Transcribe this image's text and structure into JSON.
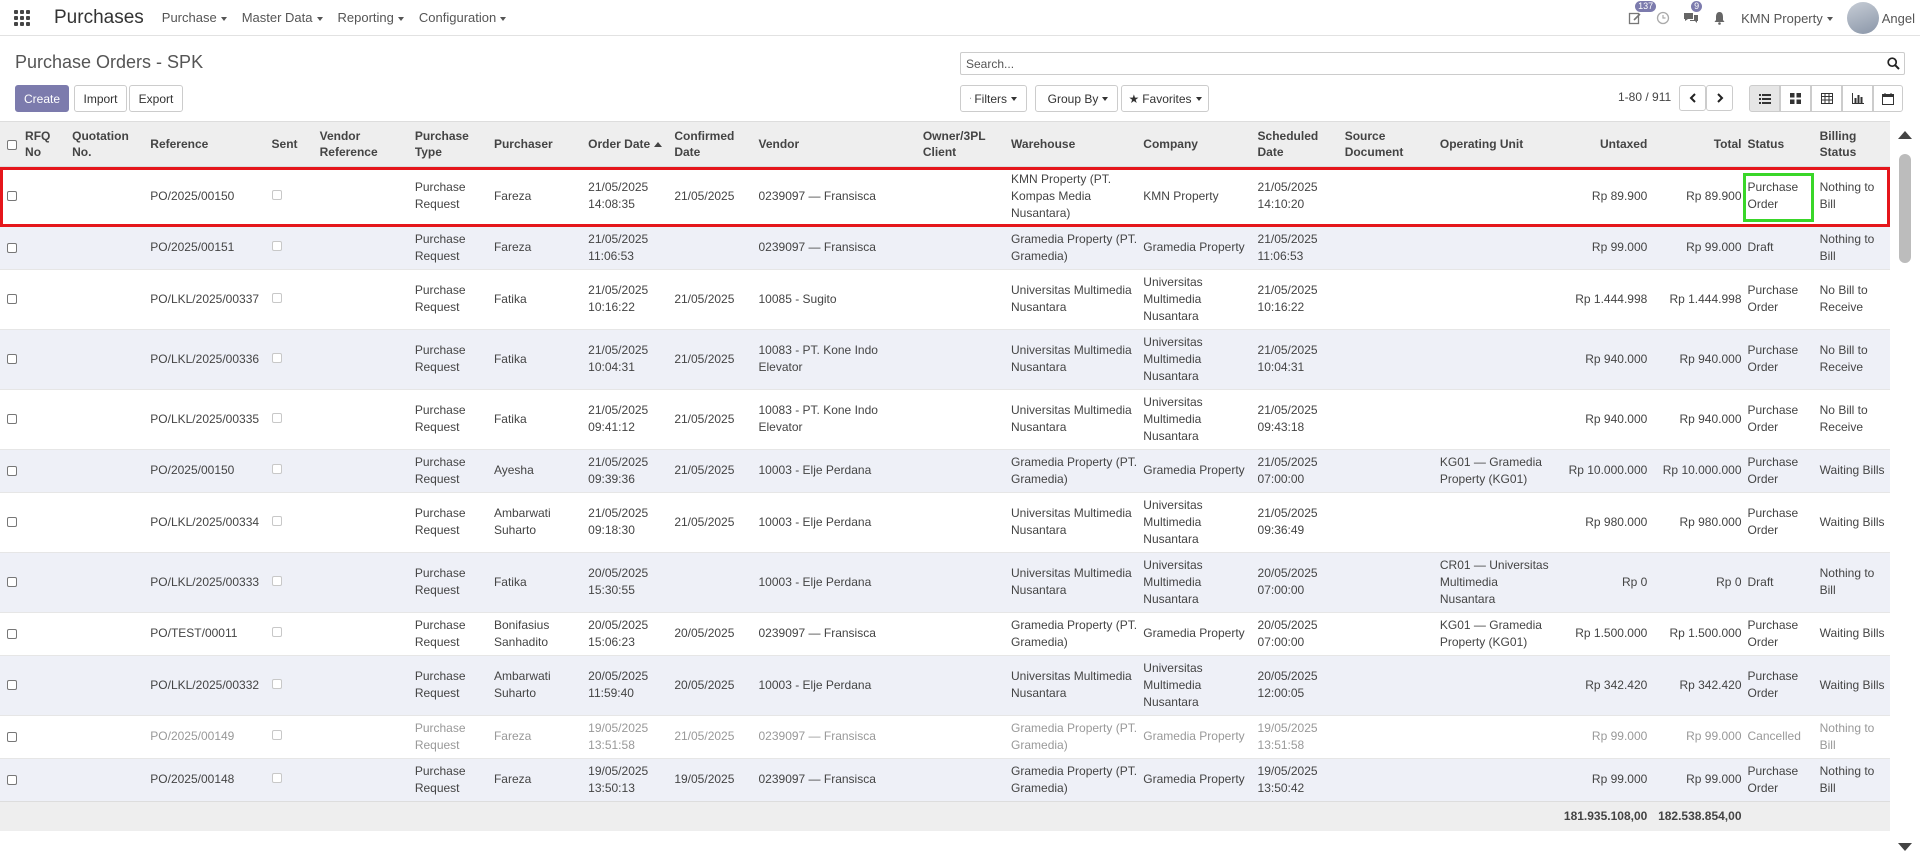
{
  "navbar": {
    "app_title": "Purchases",
    "menus": [
      "Purchase",
      "Master Data",
      "Reporting",
      "Configuration"
    ],
    "activity_badge": "137",
    "messages_badge": "9",
    "company": "KMN Property",
    "user": "Angel"
  },
  "control_panel": {
    "title": "Purchase Orders - SPK",
    "create_label": "Create",
    "import_label": "Import",
    "export_label": "Export",
    "search_placeholder": "Search...",
    "filters_label": "Filters",
    "groupby_label": "Group By",
    "favorites_label": "Favorites",
    "pager": "1-80 / 911"
  },
  "table": {
    "columns": {
      "rfq_no": "RFQ No",
      "quotation_no": "Quotation No.",
      "reference": "Reference",
      "sent": "Sent",
      "vendor_ref": "Vendor Reference",
      "purchase_type": "Purchase Type",
      "purchaser": "Purchaser",
      "order_date": "Order Date",
      "confirmed_date": "Confirmed Date",
      "vendor": "Vendor",
      "owner": "Owner/3PL Client",
      "warehouse": "Warehouse",
      "company": "Company",
      "scheduled_date": "Scheduled Date",
      "source_doc": "Source Document",
      "operating_unit": "Operating Unit",
      "untaxed": "Untaxed",
      "total": "Total",
      "status": "Status",
      "billing_status": "Billing Status"
    },
    "rows": [
      {
        "reference": "PO/2025/00150",
        "purchase_type": "Purchase Request",
        "purchaser": "Fareza",
        "order_date": "21/05/2025 14:08:35",
        "confirmed_date": "21/05/2025",
        "vendor": "0239097 — Fransisca",
        "warehouse": "KMN Property (PT. Kompas Media Nusantara)",
        "company": "KMN Property",
        "scheduled_date": "21/05/2025 14:10:20",
        "operating_unit": "",
        "untaxed": "Rp 89.900",
        "total": "Rp 89.900",
        "status": "Purchase Order",
        "billing_status": "Nothing to Bill"
      },
      {
        "reference": "PO/2025/00151",
        "purchase_type": "Purchase Request",
        "purchaser": "Fareza",
        "order_date": "21/05/2025 11:06:53",
        "confirmed_date": "",
        "vendor": "0239097 — Fransisca",
        "warehouse": "Gramedia Property (PT. Gramedia)",
        "company": "Gramedia Property",
        "scheduled_date": "21/05/2025 11:06:53",
        "operating_unit": "",
        "untaxed": "Rp 99.000",
        "total": "Rp 99.000",
        "status": "Draft",
        "billing_status": "Nothing to Bill"
      },
      {
        "reference": "PO/LKL/2025/00337",
        "purchase_type": "Purchase Request",
        "purchaser": "Fatika",
        "order_date": "21/05/2025 10:16:22",
        "confirmed_date": "21/05/2025",
        "vendor": "10085 - Sugito",
        "warehouse": "Universitas Multimedia Nusantara",
        "company": "Universitas Multimedia Nusantara",
        "scheduled_date": "21/05/2025 10:16:22",
        "operating_unit": "",
        "untaxed": "Rp 1.444.998",
        "total": "Rp 1.444.998",
        "status": "Purchase Order",
        "billing_status": "No Bill to Receive"
      },
      {
        "reference": "PO/LKL/2025/00336",
        "purchase_type": "Purchase Request",
        "purchaser": "Fatika",
        "order_date": "21/05/2025 10:04:31",
        "confirmed_date": "21/05/2025",
        "vendor": "10083 - PT. Kone Indo Elevator",
        "warehouse": "Universitas Multimedia Nusantara",
        "company": "Universitas Multimedia Nusantara",
        "scheduled_date": "21/05/2025 10:04:31",
        "operating_unit": "",
        "untaxed": "Rp 940.000",
        "total": "Rp 940.000",
        "status": "Purchase Order",
        "billing_status": "No Bill to Receive"
      },
      {
        "reference": "PO/LKL/2025/00335",
        "purchase_type": "Purchase Request",
        "purchaser": "Fatika",
        "order_date": "21/05/2025 09:41:12",
        "confirmed_date": "21/05/2025",
        "vendor": "10083 - PT. Kone Indo Elevator",
        "warehouse": "Universitas Multimedia Nusantara",
        "company": "Universitas Multimedia Nusantara",
        "scheduled_date": "21/05/2025 09:43:18",
        "operating_unit": "",
        "untaxed": "Rp 940.000",
        "total": "Rp 940.000",
        "status": "Purchase Order",
        "billing_status": "No Bill to Receive"
      },
      {
        "reference": "PO/2025/00150",
        "purchase_type": "Purchase Request",
        "purchaser": "Ayesha",
        "order_date": "21/05/2025 09:39:36",
        "confirmed_date": "21/05/2025",
        "vendor": "10003 - Elje Perdana",
        "warehouse": "Gramedia Property (PT. Gramedia)",
        "company": "Gramedia Property",
        "scheduled_date": "21/05/2025 07:00:00",
        "operating_unit": "KG01 — Gramedia Property (KG01)",
        "untaxed": "Rp 10.000.000",
        "total": "Rp 10.000.000",
        "status": "Purchase Order",
        "billing_status": "Waiting Bills"
      },
      {
        "reference": "PO/LKL/2025/00334",
        "purchase_type": "Purchase Request",
        "purchaser": "Ambarwati Suharto",
        "order_date": "21/05/2025 09:18:30",
        "confirmed_date": "21/05/2025",
        "vendor": "10003 - Elje Perdana",
        "warehouse": "Universitas Multimedia Nusantara",
        "company": "Universitas Multimedia Nusantara",
        "scheduled_date": "21/05/2025 09:36:49",
        "operating_unit": "",
        "untaxed": "Rp 980.000",
        "total": "Rp 980.000",
        "status": "Purchase Order",
        "billing_status": "Waiting Bills"
      },
      {
        "reference": "PO/LKL/2025/00333",
        "purchase_type": "Purchase Request",
        "purchaser": "Fatika",
        "order_date": "20/05/2025 15:30:55",
        "confirmed_date": "",
        "vendor": "10003 - Elje Perdana",
        "warehouse": "Universitas Multimedia Nusantara",
        "company": "Universitas Multimedia Nusantara",
        "scheduled_date": "20/05/2025 07:00:00",
        "operating_unit": "CR01 — Universitas Multimedia Nusantara",
        "untaxed": "Rp 0",
        "total": "Rp 0",
        "status": "Draft",
        "billing_status": "Nothing to Bill"
      },
      {
        "reference": "PO/TEST/00011",
        "purchase_type": "Purchase Request",
        "purchaser": "Bonifasius Sanhadito",
        "order_date": "20/05/2025 15:06:23",
        "confirmed_date": "20/05/2025",
        "vendor": "0239097 — Fransisca",
        "warehouse": "Gramedia Property (PT. Gramedia)",
        "company": "Gramedia Property",
        "scheduled_date": "20/05/2025 07:00:00",
        "operating_unit": "KG01 — Gramedia Property (KG01)",
        "untaxed": "Rp 1.500.000",
        "total": "Rp 1.500.000",
        "status": "Purchase Order",
        "billing_status": "Waiting Bills"
      },
      {
        "reference": "PO/LKL/2025/00332",
        "purchase_type": "Purchase Request",
        "purchaser": "Ambarwati Suharto",
        "order_date": "20/05/2025 11:59:40",
        "confirmed_date": "20/05/2025",
        "vendor": "10003 - Elje Perdana",
        "warehouse": "Universitas Multimedia Nusantara",
        "company": "Universitas Multimedia Nusantara",
        "scheduled_date": "20/05/2025 12:00:05",
        "operating_unit": "",
        "untaxed": "Rp 342.420",
        "total": "Rp 342.420",
        "status": "Purchase Order",
        "billing_status": "Waiting Bills"
      },
      {
        "reference": "PO/2025/00149",
        "purchase_type": "Purchase Request",
        "purchaser": "Fareza",
        "order_date": "19/05/2025 13:51:58",
        "confirmed_date": "21/05/2025",
        "vendor": "0239097 — Fransisca",
        "warehouse": "Gramedia Property (PT. Gramedia)",
        "company": "Gramedia Property",
        "scheduled_date": "19/05/2025 13:51:58",
        "operating_unit": "",
        "untaxed": "Rp 99.000",
        "total": "Rp 99.000",
        "status": "Cancelled",
        "billing_status": "Nothing to Bill"
      },
      {
        "reference": "PO/2025/00148",
        "purchase_type": "Purchase Request",
        "purchaser": "Fareza",
        "order_date": "19/05/2025 13:50:13",
        "confirmed_date": "19/05/2025",
        "vendor": "0239097 — Fransisca",
        "warehouse": "Gramedia Property (PT. Gramedia)",
        "company": "Gramedia Property",
        "scheduled_date": "19/05/2025 13:50:42",
        "operating_unit": "",
        "untaxed": "Rp 99.000",
        "total": "Rp 99.000",
        "status": "Purchase Order",
        "billing_status": "Nothing to Bill"
      }
    ],
    "totals": {
      "untaxed": "181.935.108,00",
      "total": "182.538.854,00"
    }
  }
}
